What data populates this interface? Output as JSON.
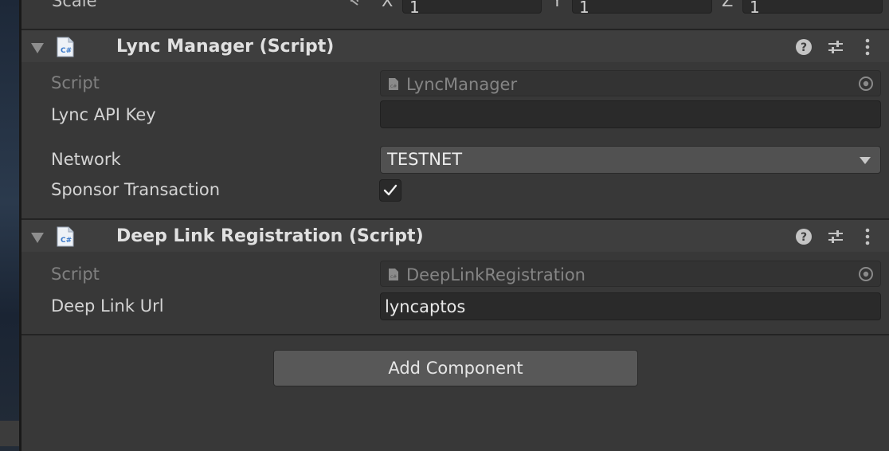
{
  "transform": {
    "scale_label": "Scale",
    "x_label": "X",
    "x_value": "1",
    "y_label": "Y",
    "y_value": "1",
    "z_label": "Z",
    "z_value": "1"
  },
  "components": [
    {
      "title": "Lync Manager (Script)",
      "script_label": "Script",
      "script_value": "LyncManager",
      "props": {
        "api_key_label": "Lync API Key",
        "api_key_value": "",
        "network_label": "Network",
        "network_value": "TESTNET",
        "sponsor_label": "Sponsor Transaction",
        "sponsor_checked": true
      }
    },
    {
      "title": "Deep Link Registration (Script)",
      "script_label": "Script",
      "script_value": "DeepLinkRegistration",
      "props": {
        "url_label": "Deep Link Url",
        "url_value": "lyncaptos"
      }
    }
  ],
  "add_component_label": "Add Component",
  "icons": {
    "fold": "foldout-triangle-icon",
    "script": "csharp-script-icon",
    "help": "help-icon",
    "presets": "presets-sliders-icon",
    "menu": "kebab-menu-icon",
    "picker": "object-picker-icon",
    "constrain": "constrain-proportions-icon",
    "check": "checkmark-icon"
  },
  "colors": {
    "panel_bg": "#383838",
    "header_bg": "#3e3e3e",
    "field_bg": "#2a2a2a",
    "dropdown_bg": "#515151",
    "button_bg": "#585858"
  }
}
